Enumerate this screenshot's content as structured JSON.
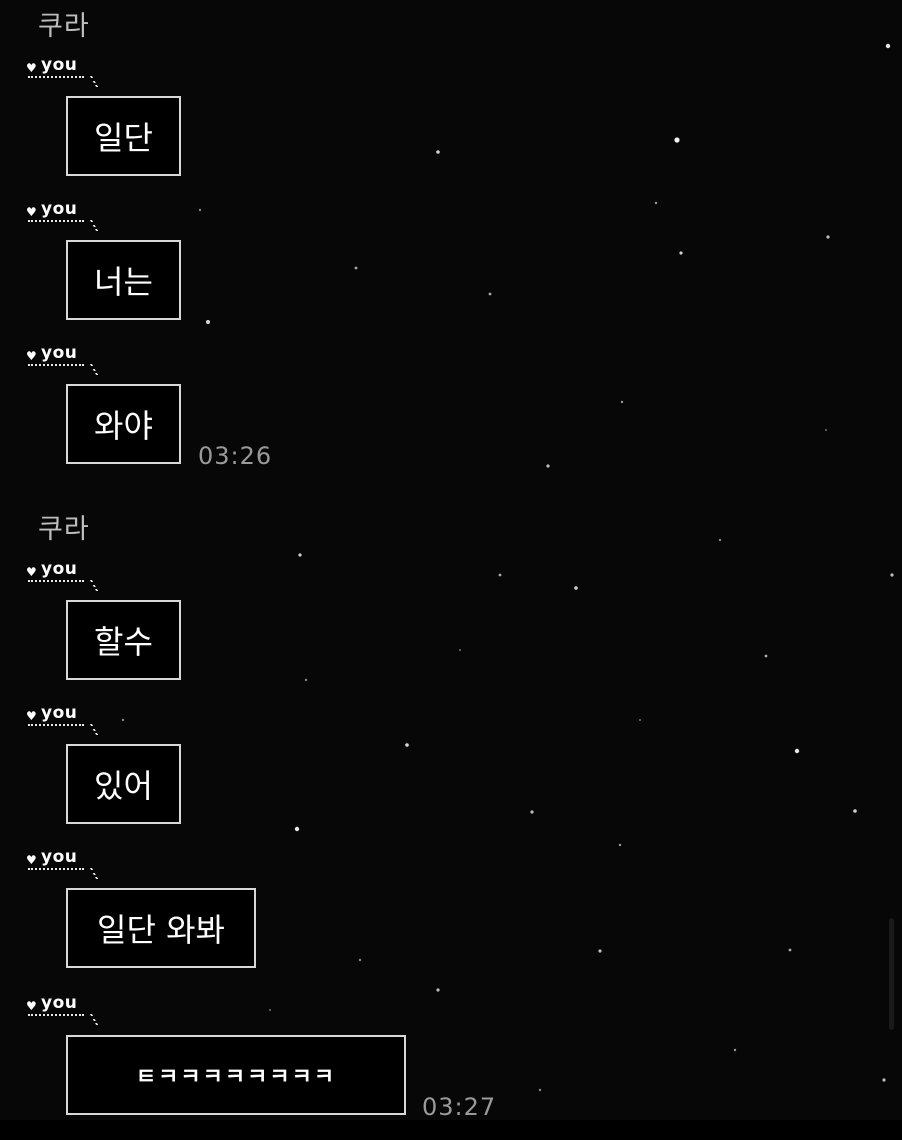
{
  "chat": {
    "groups": [
      {
        "sender": "쿠라",
        "tag": "you",
        "messages": [
          "일단",
          "너는",
          "와야"
        ],
        "time": "03:26"
      },
      {
        "sender": "쿠라",
        "tag": "you",
        "messages": [
          "할수",
          "있어",
          "일단 와봐",
          "ㅌㅋㅋㅋㅋㅋㅋㅋㅋ"
        ],
        "time": "03:27"
      }
    ]
  },
  "theme": {
    "background": "#070707",
    "bubble_border": "#d8d8d8",
    "text": "#ffffff",
    "muted_text": "#9a9a9a",
    "heart_icon": "heart-icon"
  }
}
